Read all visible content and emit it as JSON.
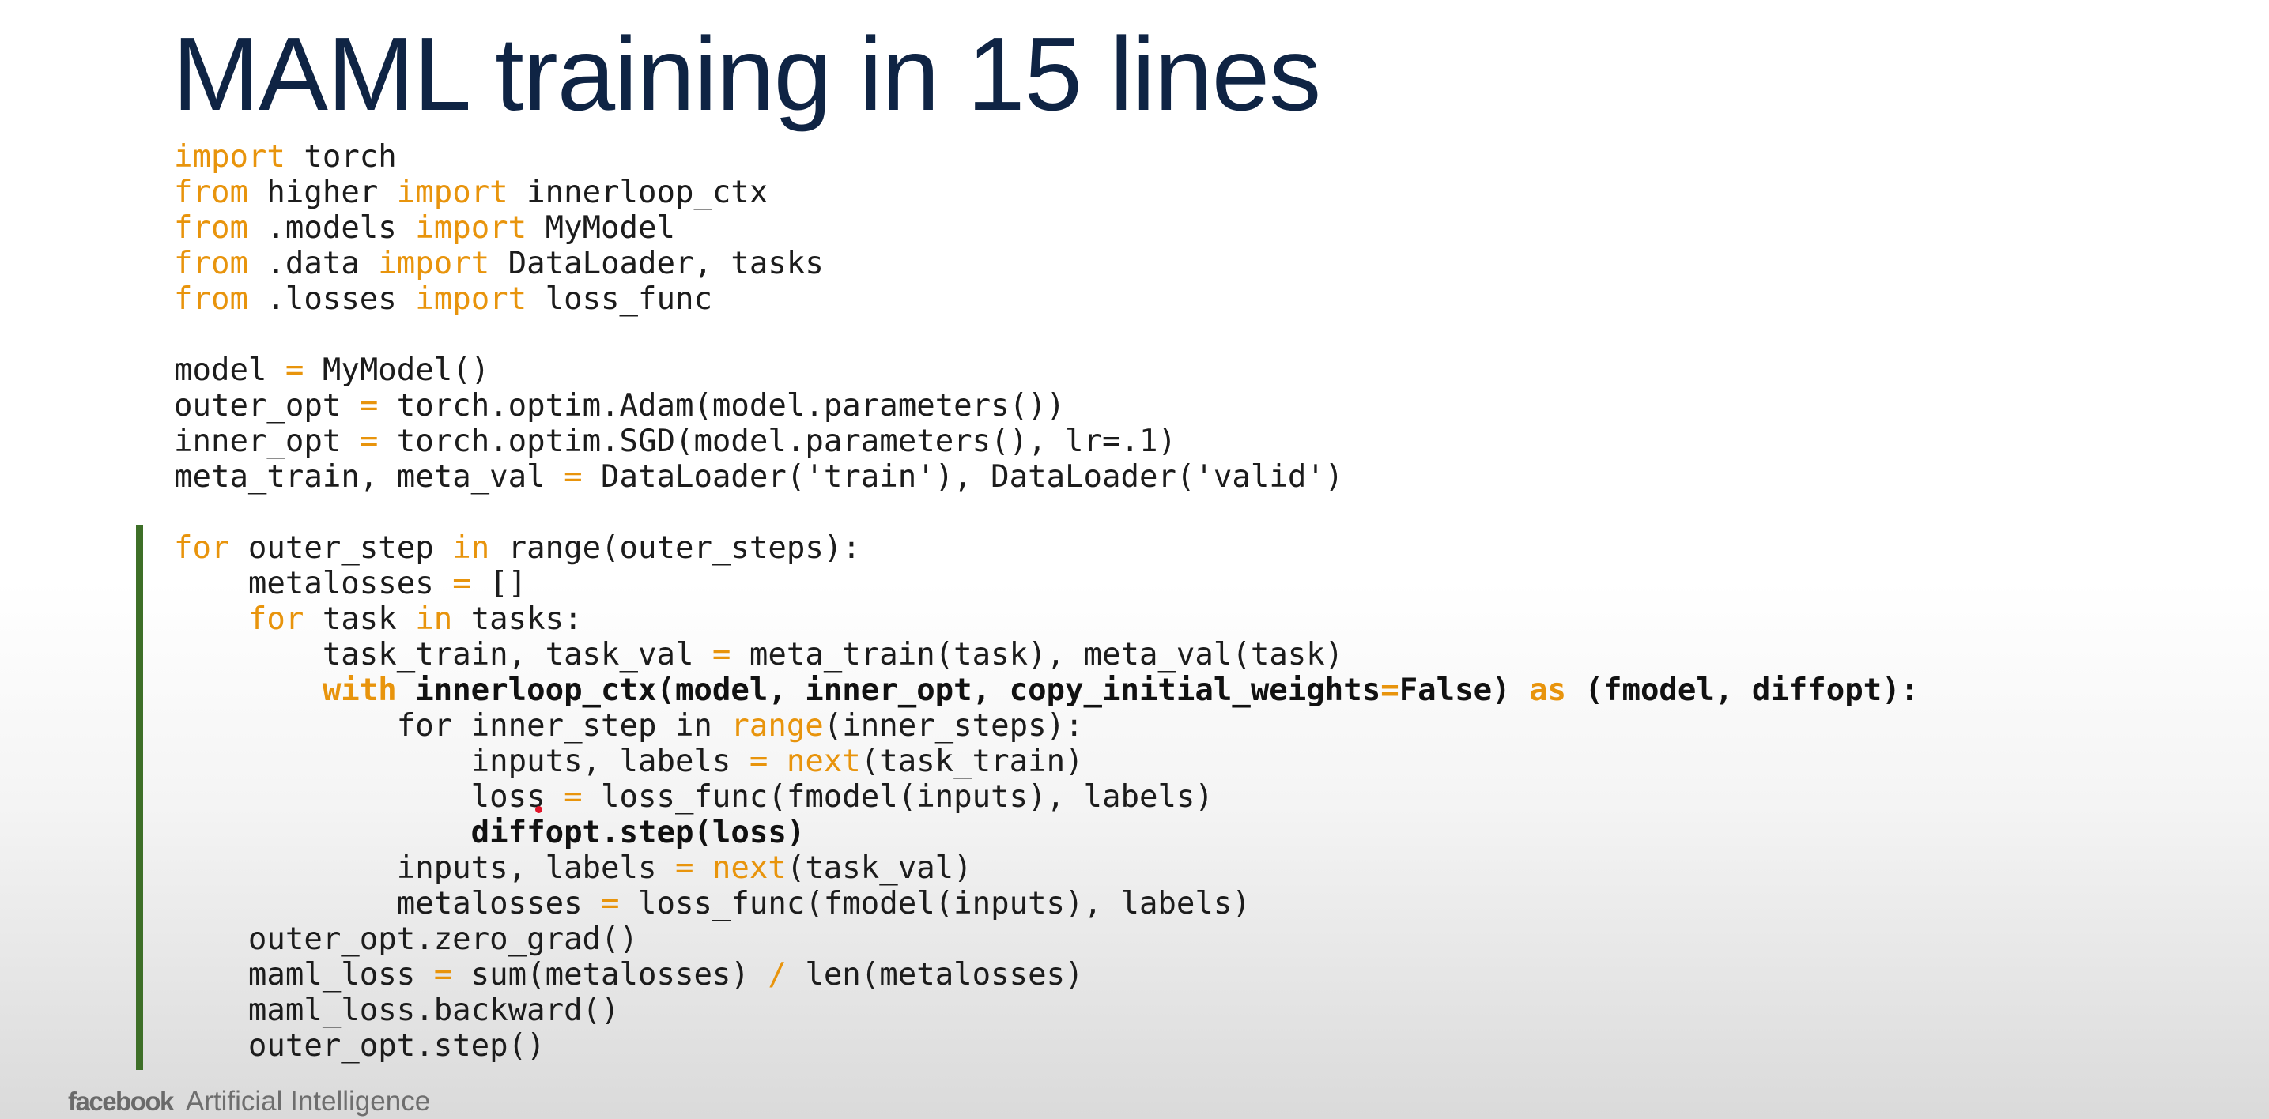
{
  "slide": {
    "title": "MAML training in 15 lines",
    "footer": {
      "logo_text": "facebook",
      "text": "Artificial Intelligence"
    },
    "colors": {
      "title": "#0f2444",
      "keyword": "#e8940c",
      "code": "#1c1c1c",
      "accent_bar": "#3e6f28",
      "pointer": "#e0152a",
      "footer": "#6e6e6e"
    },
    "icons": [
      "facebook-logo",
      "laser-pointer-dot"
    ],
    "code_lines": [
      {
        "indent": 0,
        "tokens": [
          {
            "t": "import",
            "s": "k"
          },
          {
            "t": " torch",
            "s": "t"
          }
        ]
      },
      {
        "indent": 0,
        "tokens": [
          {
            "t": "from",
            "s": "k"
          },
          {
            "t": " higher ",
            "s": "t"
          },
          {
            "t": "import",
            "s": "k"
          },
          {
            "t": " innerloop_ctx",
            "s": "t"
          }
        ]
      },
      {
        "indent": 0,
        "tokens": [
          {
            "t": "from",
            "s": "k"
          },
          {
            "t": " .models ",
            "s": "t"
          },
          {
            "t": "import",
            "s": "k"
          },
          {
            "t": " MyModel",
            "s": "t"
          }
        ]
      },
      {
        "indent": 0,
        "tokens": [
          {
            "t": "from",
            "s": "k"
          },
          {
            "t": " .data ",
            "s": "t"
          },
          {
            "t": "import",
            "s": "k"
          },
          {
            "t": " DataLoader, tasks",
            "s": "t"
          }
        ]
      },
      {
        "indent": 0,
        "tokens": [
          {
            "t": "from",
            "s": "k"
          },
          {
            "t": " .losses ",
            "s": "t"
          },
          {
            "t": "import",
            "s": "k"
          },
          {
            "t": " loss_func",
            "s": "t"
          }
        ]
      },
      {
        "blank": true
      },
      {
        "indent": 0,
        "tokens": [
          {
            "t": "model ",
            "s": "t"
          },
          {
            "t": "=",
            "s": "k"
          },
          {
            "t": " MyModel()",
            "s": "t"
          }
        ]
      },
      {
        "indent": 0,
        "tokens": [
          {
            "t": "outer_opt ",
            "s": "t"
          },
          {
            "t": "=",
            "s": "k"
          },
          {
            "t": " torch.optim.Adam(model.parameters())",
            "s": "t"
          }
        ]
      },
      {
        "indent": 0,
        "tokens": [
          {
            "t": "inner_opt ",
            "s": "t"
          },
          {
            "t": "=",
            "s": "k"
          },
          {
            "t": " torch.optim.SGD(model.parameters(), lr=.1)",
            "s": "t"
          }
        ]
      },
      {
        "indent": 0,
        "tokens": [
          {
            "t": "meta_train, meta_val ",
            "s": "t"
          },
          {
            "t": "=",
            "s": "k"
          },
          {
            "t": " DataLoader('train'), DataLoader('valid')",
            "s": "t"
          }
        ]
      },
      {
        "blank": true
      },
      {
        "indent": 0,
        "tokens": [
          {
            "t": "for",
            "s": "k"
          },
          {
            "t": " outer_step ",
            "s": "t"
          },
          {
            "t": "in",
            "s": "k"
          },
          {
            "t": " range(outer_steps):",
            "s": "t"
          }
        ]
      },
      {
        "indent": 1,
        "tokens": [
          {
            "t": "metalosses ",
            "s": "t"
          },
          {
            "t": "=",
            "s": "k"
          },
          {
            "t": " []",
            "s": "t"
          }
        ]
      },
      {
        "indent": 1,
        "tokens": [
          {
            "t": "for",
            "s": "k"
          },
          {
            "t": " task ",
            "s": "t"
          },
          {
            "t": "in",
            "s": "k"
          },
          {
            "t": " tasks:",
            "s": "t"
          }
        ]
      },
      {
        "indent": 2,
        "tokens": [
          {
            "t": "task_train, task_val ",
            "s": "t"
          },
          {
            "t": "=",
            "s": "k"
          },
          {
            "t": " meta_train(task), meta_val(task)",
            "s": "t"
          }
        ]
      },
      {
        "indent": 2,
        "tokens": [
          {
            "t": "with",
            "s": "kb"
          },
          {
            "t": " innerloop_ctx(model, inner_opt, copy_initial_weights",
            "s": "b"
          },
          {
            "t": "=",
            "s": "kb"
          },
          {
            "t": "False) ",
            "s": "b"
          },
          {
            "t": "as",
            "s": "kb"
          },
          {
            "t": " (fmodel, diffopt):",
            "s": "b"
          }
        ]
      },
      {
        "indent": 3,
        "tokens": [
          {
            "t": "for inner_step in ",
            "s": "t"
          },
          {
            "t": "range",
            "s": "k"
          },
          {
            "t": "(inner_steps):",
            "s": "t"
          }
        ]
      },
      {
        "indent": 4,
        "tokens": [
          {
            "t": "inputs, labels ",
            "s": "t"
          },
          {
            "t": "=",
            "s": "k"
          },
          {
            "t": " ",
            "s": "t"
          },
          {
            "t": "next",
            "s": "k"
          },
          {
            "t": "(task_train)",
            "s": "t"
          }
        ]
      },
      {
        "indent": 4,
        "tokens": [
          {
            "t": "loss ",
            "s": "t"
          },
          {
            "t": "=",
            "s": "k"
          },
          {
            "t": " loss_func(fmodel(inputs), labels)",
            "s": "t"
          }
        ]
      },
      {
        "indent": 4,
        "tokens": [
          {
            "t": "diffopt.step(loss)",
            "s": "b"
          }
        ]
      },
      {
        "indent": 3,
        "tokens": [
          {
            "t": "inputs, labels ",
            "s": "t"
          },
          {
            "t": "=",
            "s": "k"
          },
          {
            "t": " ",
            "s": "t"
          },
          {
            "t": "next",
            "s": "k"
          },
          {
            "t": "(task_val)",
            "s": "t"
          }
        ]
      },
      {
        "indent": 3,
        "tokens": [
          {
            "t": "metalosses ",
            "s": "t"
          },
          {
            "t": "=",
            "s": "k"
          },
          {
            "t": " loss_func(fmodel(inputs), labels)",
            "s": "t"
          }
        ]
      },
      {
        "indent": 1,
        "tokens": [
          {
            "t": "outer_opt.zero_grad()",
            "s": "t"
          }
        ]
      },
      {
        "indent": 1,
        "tokens": [
          {
            "t": "maml_loss ",
            "s": "t"
          },
          {
            "t": "=",
            "s": "k"
          },
          {
            "t": " sum(metalosses) ",
            "s": "t"
          },
          {
            "t": "/",
            "s": "k"
          },
          {
            "t": " len(metalosses)",
            "s": "t"
          }
        ]
      },
      {
        "indent": 1,
        "tokens": [
          {
            "t": "maml_loss.backward()",
            "s": "t"
          }
        ]
      },
      {
        "indent": 1,
        "tokens": [
          {
            "t": "outer_opt.step()",
            "s": "t"
          }
        ]
      }
    ]
  }
}
